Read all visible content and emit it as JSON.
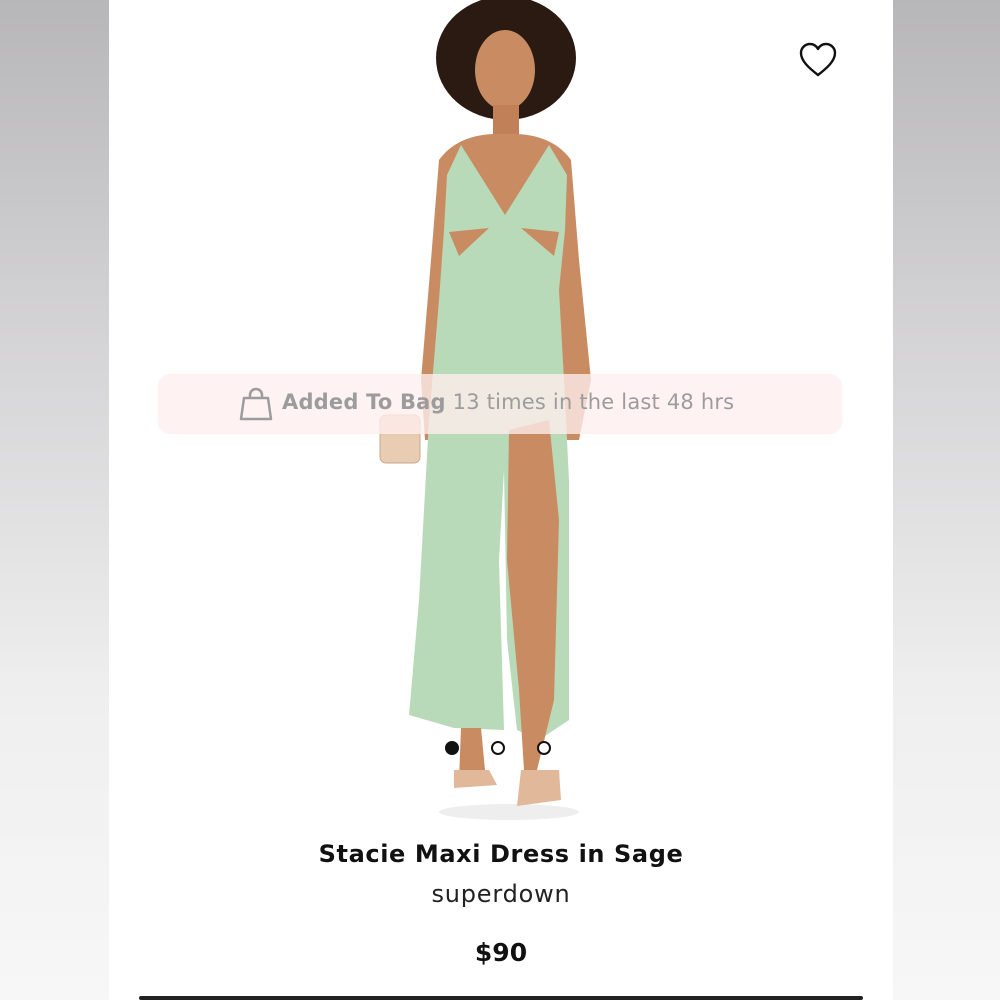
{
  "product": {
    "title": "Stacie Maxi Dress in Sage",
    "brand": "superdown",
    "price": "$90"
  },
  "toast": {
    "prefix": "Added To Bag",
    "suffix": " 13 times in the last 48 hrs",
    "icon": "shopping-bag-icon"
  },
  "wishlist": {
    "icon": "heart-icon"
  },
  "carousel": {
    "total": 3,
    "active_index": 0
  },
  "colors": {
    "dress": "#b9dab8",
    "skin": "#c98b62",
    "hair": "#2a1a12",
    "toast_bg": "#ffeeee",
    "text": "#111111"
  }
}
